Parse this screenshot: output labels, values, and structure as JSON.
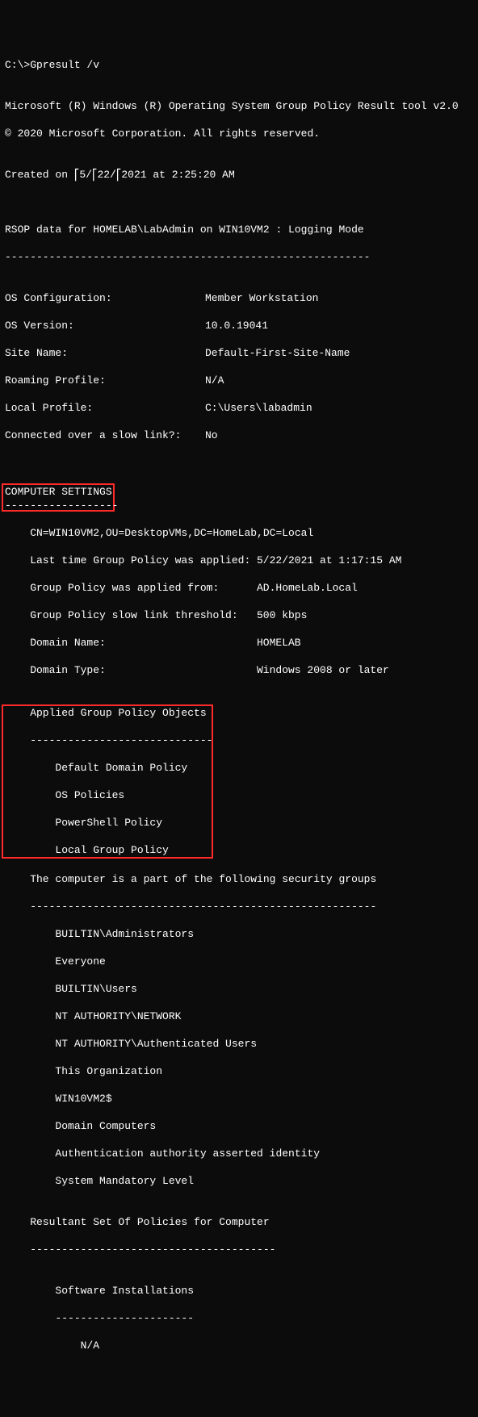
{
  "prompt": "C:\\>Gpresult /v",
  "blank": "",
  "header1": "Microsoft (R) Windows (R) Operating System Group Policy Result tool v2.0",
  "header2": "© 2020 Microsoft Corporation. All rights reserved.",
  "created_prefix": "Created on ",
  "created_sep1": "5/",
  "created_sep2": "22/",
  "created_rest": "2021 at 2:25:20 AM",
  "rsop": "RSOP data for HOMELAB\\LabAdmin on WIN10VM2 : Logging Mode",
  "rsop_dash": "----------------------------------------------------------",
  "os": {
    "cfg_l": "OS Configuration:",
    "cfg_v": "Member Workstation",
    "ver_l": "OS Version:",
    "ver_v": "10.0.19041",
    "site_l": "Site Name:",
    "site_v": "Default-First-Site-Name",
    "roam_l": "Roaming Profile:",
    "roam_v": "N/A",
    "local_l": "Local Profile:",
    "local_v": "C:\\Users\\labadmin",
    "slow_l": "Connected over a slow link?:",
    "slow_v": "No"
  },
  "comp_sett": "COMPUTER SETTINGS",
  "comp_dash": "------------------",
  "gp": {
    "cn": "    CN=WIN10VM2,OU=DesktopVMs,DC=HomeLab,DC=Local",
    "last_l": "    Last time Group Policy was applied:",
    "last_v": "5/22/2021 at 1:17:15 AM",
    "from_l": "    Group Policy was applied from:",
    "from_v": "AD.HomeLab.Local",
    "thr_l": "    Group Policy slow link threshold:",
    "thr_v": "500 kbps",
    "dom_l": "    Domain Name:",
    "dom_v": "HOMELAB",
    "type_l": "    Domain Type:",
    "type_v": "Windows 2008 or later"
  },
  "agpo_title": "    Applied Group Policy Objects",
  "agpo_dash": "    -----------------------------",
  "agpo1": "        Default Domain Policy",
  "agpo2": "        OS Policies",
  "agpo3": "        PowerShell Policy",
  "agpo4": "        Local Group Policy",
  "sec_title": "    The computer is a part of the following security groups",
  "sec_dash": "    -------------------------------------------------------",
  "sec1": "        BUILTIN\\Administrators",
  "sec2": "        Everyone",
  "sec3": "        BUILTIN\\Users",
  "sec4": "        NT AUTHORITY\\NETWORK",
  "sec5": "        NT AUTHORITY\\Authenticated Users",
  "sec6": "        This Organization",
  "sec7": "        WIN10VM2$",
  "sec8": "        Domain Computers",
  "sec9": "        Authentication authority asserted identity",
  "sec10": "        System Mandatory Level",
  "rsop2_title": "    Resultant Set Of Policies for Computer",
  "rsop2_dash": "    ---------------------------------------",
  "sw_title": "        Software Installations",
  "sw_dash": "        ----------------------",
  "sw_na": "            N/A",
  "up": "⎡"
}
